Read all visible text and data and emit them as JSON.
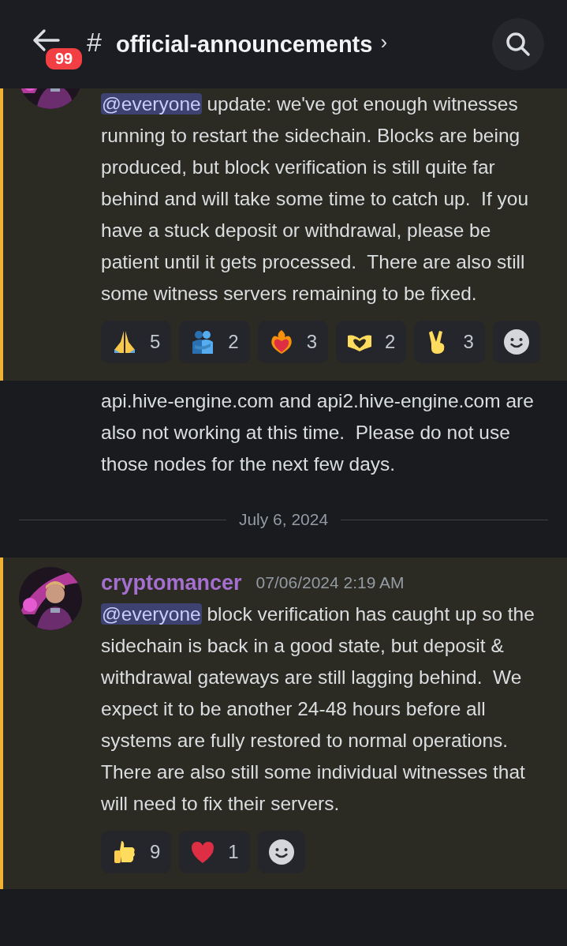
{
  "header": {
    "back_badge": "99",
    "hash": "#",
    "title": "official-announcements",
    "chevron": "›"
  },
  "messages": [
    {
      "kind": "cut",
      "highlighted": true,
      "mention": "@everyone",
      "text": " update: we've got enough witnesses running to restart the sidechain. Blocks are being produced, but block verification is still quite far behind and will take some time to catch up.  If you have a stuck deposit or withdrawal, please be patient until it gets processed.  There are also still some witness servers remaining to be fixed.",
      "reactions": [
        {
          "kind": "pray",
          "count": "5"
        },
        {
          "kind": "hug",
          "count": "2"
        },
        {
          "kind": "fire-heart",
          "count": "3"
        },
        {
          "kind": "heart-hands",
          "count": "2"
        },
        {
          "kind": "victory",
          "count": "3"
        },
        {
          "kind": "add"
        }
      ]
    },
    {
      "kind": "continued",
      "highlighted": false,
      "text": "api.hive-engine.com and api2.hive-engine.com are also not working at this time.  Please do not use those nodes for the next few days."
    },
    {
      "kind": "divider",
      "text": "July 6, 2024"
    },
    {
      "kind": "full",
      "highlighted": true,
      "author": "cryptomancer",
      "time": "07/06/2024 2:19 AM",
      "mention": "@everyone",
      "text": " block verification has caught up so the sidechain is back in a good state, but deposit & withdrawal gateways are still lagging behind.  We expect it to be another 24-48 hours before all systems are fully restored to normal operations.  There are also still some individual witnesses that will need to fix their servers.",
      "reactions": [
        {
          "kind": "thumbs-up",
          "count": "9"
        },
        {
          "kind": "heart",
          "count": "1"
        },
        {
          "kind": "add"
        }
      ]
    }
  ]
}
